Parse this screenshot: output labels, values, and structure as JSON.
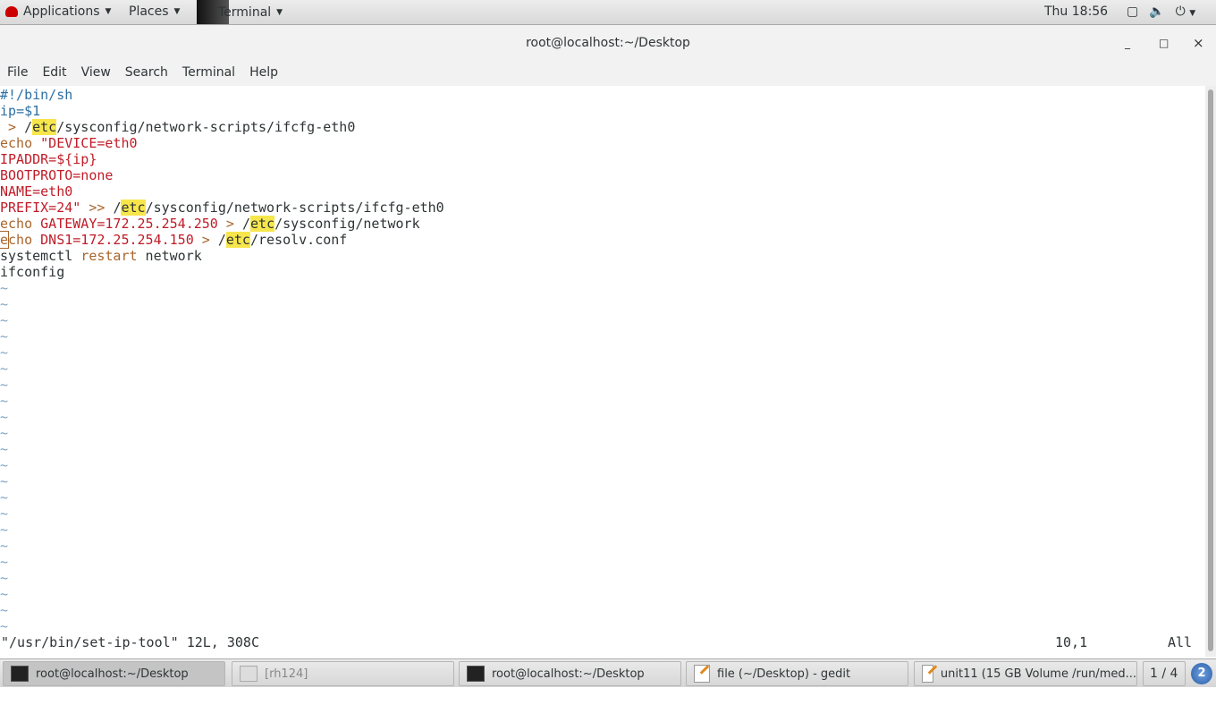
{
  "topbar": {
    "applications": "Applications",
    "places": "Places",
    "terminal": "Terminal",
    "clock": "Thu 18:56"
  },
  "window": {
    "title": "root@localhost:~/Desktop",
    "minimize": "_",
    "maximize": "□",
    "close": "×"
  },
  "menu": [
    "File",
    "Edit",
    "View",
    "Search",
    "Terminal",
    "Help"
  ],
  "editor": {
    "lines": [
      [
        {
          "t": "#!/bin/sh",
          "c": "cm"
        }
      ],
      [
        {
          "t": "ip",
          "c": "cm"
        },
        {
          "t": "=$1",
          "c": "cm"
        }
      ],
      [
        {
          "t": " > ",
          "c": "kw"
        },
        {
          "t": "/",
          "c": ""
        },
        {
          "t": "etc",
          "c": "hl"
        },
        {
          "t": "/sysconfig/network-scripts/ifcfg-eth0",
          "c": ""
        }
      ],
      [
        {
          "t": "echo ",
          "c": "kw"
        },
        {
          "t": "\"DEVICE=eth0",
          "c": "st"
        }
      ],
      [
        {
          "t": "IPADDR=${ip}",
          "c": "st"
        }
      ],
      [
        {
          "t": "BOOTPROTO=none",
          "c": "st"
        }
      ],
      [
        {
          "t": "NAME=eth0",
          "c": "st"
        }
      ],
      [
        {
          "t": "PREFIX=24\"",
          "c": "st"
        },
        {
          "t": " >> ",
          "c": "kw"
        },
        {
          "t": "/",
          "c": ""
        },
        {
          "t": "etc",
          "c": "hl"
        },
        {
          "t": "/sysconfig/network-scripts/ifcfg-eth0",
          "c": ""
        }
      ],
      [
        {
          "t": "echo ",
          "c": "kw"
        },
        {
          "t": "GATEWAY=172.25.254.250",
          "c": "st"
        },
        {
          "t": " > ",
          "c": "kw"
        },
        {
          "t": "/",
          "c": ""
        },
        {
          "t": "etc",
          "c": "hl"
        },
        {
          "t": "/sysconfig/network",
          "c": ""
        }
      ],
      [
        {
          "t": "e",
          "c": "kw cur"
        },
        {
          "t": "cho ",
          "c": "kw"
        },
        {
          "t": "DNS1=172.25.254.150",
          "c": "st"
        },
        {
          "t": " > ",
          "c": "kw"
        },
        {
          "t": "/",
          "c": ""
        },
        {
          "t": "etc",
          "c": "hl"
        },
        {
          "t": "/resolv.conf",
          "c": ""
        }
      ],
      [
        {
          "t": "systemctl ",
          "c": ""
        },
        {
          "t": "restart",
          "c": "kw"
        },
        {
          "t": " network",
          "c": ""
        }
      ],
      [
        {
          "t": "ifconfig",
          "c": ""
        }
      ]
    ],
    "empty_marker": "~",
    "empty_count": 22,
    "status_file": "\"/usr/bin/set-ip-tool\" 12L, 308C",
    "status_pos": "10,1",
    "status_scroll": "All"
  },
  "taskbar": {
    "tasks": [
      "root@localhost:~/Desktop",
      "[rh124]",
      "root@localhost:~/Desktop",
      "file (~/Desktop) - gedit",
      "unit11 (15 GB Volume /run/med..."
    ],
    "workspace": "1 / 4",
    "notifications": "2"
  }
}
